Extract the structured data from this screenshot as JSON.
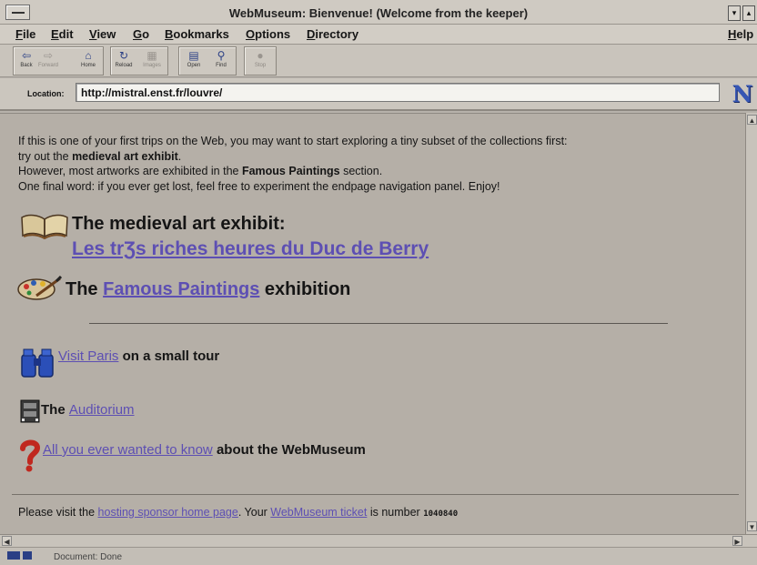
{
  "window": {
    "title": "WebMuseum: Bienvenue! (Welcome from the keeper)"
  },
  "menu": {
    "items": [
      "File",
      "Edit",
      "View",
      "Go",
      "Bookmarks",
      "Options",
      "Directory"
    ],
    "help": "Help"
  },
  "toolbar": {
    "buttons": [
      {
        "label": "Back",
        "icon": "back-arrow-icon",
        "enabled": true
      },
      {
        "label": "Forward",
        "icon": "forward-arrow-icon",
        "enabled": false
      },
      {
        "label": "Home",
        "icon": "home-icon",
        "enabled": true
      },
      {
        "label": "Reload",
        "icon": "reload-icon",
        "enabled": true
      },
      {
        "label": "Images",
        "icon": "images-icon",
        "enabled": false
      },
      {
        "label": "Open",
        "icon": "open-icon",
        "enabled": true
      },
      {
        "label": "Find",
        "icon": "find-icon",
        "enabled": true
      },
      {
        "label": "Stop",
        "icon": "stop-icon",
        "enabled": false
      }
    ]
  },
  "location": {
    "label": "Location:",
    "url": "http://mistral.enst.fr/louvre/"
  },
  "content": {
    "intro_line1": "If this is one of your first trips on the Web, you may want to start exploring a tiny subset of the collections first:",
    "intro_line2_pre": "try out the ",
    "intro_line2_bold": "medieval art exhibit",
    "intro_line2_post": ".",
    "intro_line3_pre": "However, most artworks are exhibited in the ",
    "intro_line3_bold": "Famous Paintings",
    "intro_line3_post": " section.",
    "intro_line4": "One final word: if you ever get lost, feel free to experiment the endpage navigation panel. Enjoy!",
    "medieval_heading": "The medieval art exhibit:",
    "medieval_link": "Les trƷs riches heures du Duc de Berry",
    "famous_pre": "The ",
    "famous_link": "Famous Paintings",
    "famous_post": " exhibition",
    "paris_link": "Visit Paris",
    "paris_post": " on a small tour",
    "auditorium_pre": "The ",
    "auditorium_link": "Auditorium",
    "about_link": "All you ever wanted to know",
    "about_post": " about the WebMuseum"
  },
  "footer": {
    "pre": "Please visit the ",
    "sponsor_link": "hosting sponsor home page",
    "mid": ". Your ",
    "ticket_link": "WebMuseum ticket",
    "post": " is number ",
    "ticket_number": "1040840"
  },
  "status": {
    "text": "Document: Done"
  },
  "colors": {
    "link": "#5d4fb3",
    "background": "#b5afa7",
    "netscape_logo": "#3656b4"
  }
}
